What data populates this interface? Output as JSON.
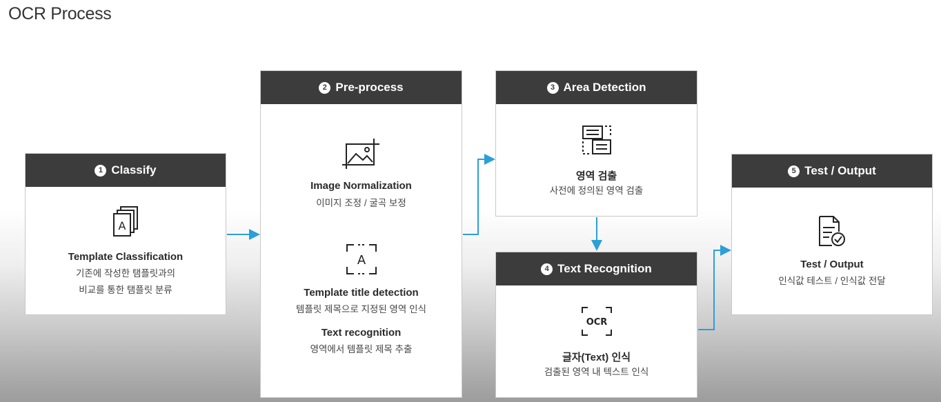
{
  "title": "OCR Process",
  "steps": [
    {
      "num": "1",
      "header": "Classify",
      "items": [
        {
          "title": "Template Classification",
          "desc": "기존에 작성한 탬플릿과의",
          "desc2": "비교를 통한 탬플릿 분류"
        }
      ]
    },
    {
      "num": "2",
      "header": "Pre-process",
      "items": [
        {
          "title": "Image Normalization",
          "desc": "이미지 조정 / 굴곡 보정"
        },
        {
          "title": "Template title detection",
          "desc": "템플릿 제목으로 지정된 영역 인식"
        },
        {
          "title": "Text recognition",
          "desc": "영역에서 템플릿 제목 추출"
        }
      ]
    },
    {
      "num": "3",
      "header": "Area Detection",
      "items": [
        {
          "title": "영역 검출",
          "desc": "사전에 정의된 영역 검출"
        }
      ]
    },
    {
      "num": "4",
      "header": "Text Recognition",
      "items": [
        {
          "title": "글자(Text) 인식",
          "desc": "검출된 영역 내 텍스트 인식"
        }
      ]
    },
    {
      "num": "5",
      "header": "Test / Output",
      "items": [
        {
          "title": "Test / Output",
          "desc": "인식값 테스트 / 인식값 전달"
        }
      ]
    }
  ],
  "icons": {
    "template_icon_letter": "A",
    "title_detect_icon_letter": "A",
    "ocr_icon_text": "OCR"
  },
  "colors": {
    "header": "#3c3c3c",
    "arrow": "#2a9fd8"
  }
}
